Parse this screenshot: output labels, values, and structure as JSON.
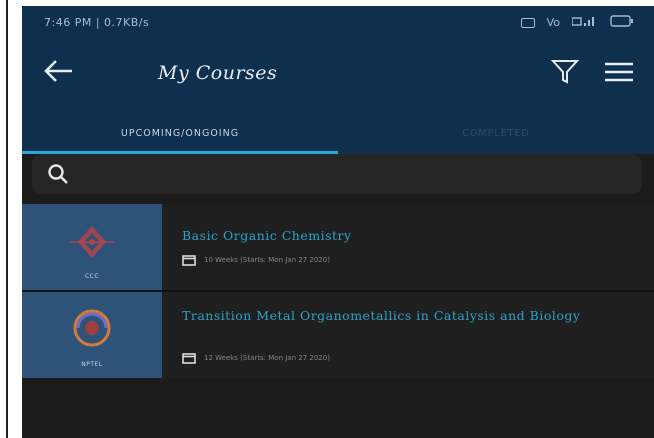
{
  "status_bar": {
    "time_info": "7:46 PM | 0.7KB/s",
    "signal_text": "Vo"
  },
  "toolbar": {
    "title": "My Courses",
    "back_icon": "arrow-left-icon",
    "filter_icon": "filter-icon",
    "menu_icon": "hamburger-menu-icon"
  },
  "tabs": [
    {
      "label": "UPCOMING/ONGOING",
      "active": true
    },
    {
      "label": "COMPLETED",
      "active": false
    }
  ],
  "search": {
    "value": "",
    "placeholder": ""
  },
  "courses": [
    {
      "provider": "CCC",
      "title": "Basic Organic Chemistry",
      "meta": "10 Weeks (Starts: Mon Jan 27 2020)"
    },
    {
      "provider": "NPTEL",
      "title": "Transition Metal Organometallics in Catalysis and Biology",
      "meta": "12 Weeks (Starts: Mon Jan 27 2020)"
    }
  ],
  "colors": {
    "appbar": "#0e2f4e",
    "accent": "#2aa9d6",
    "background": "#1c1c1c",
    "thumb": "#2d5378"
  }
}
